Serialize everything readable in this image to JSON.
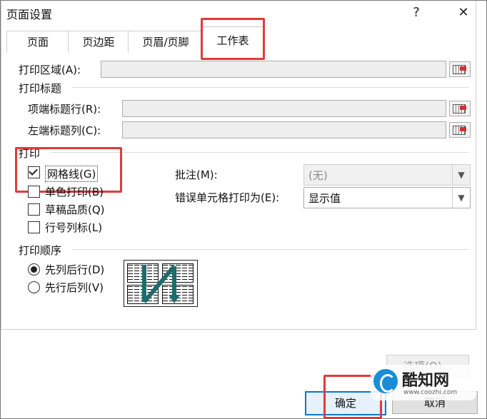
{
  "window": {
    "title": "页面设置",
    "help_symbol": "?",
    "close_symbol": "✕"
  },
  "tabs": [
    {
      "label": "页面"
    },
    {
      "label": "页边距"
    },
    {
      "label": "页眉/页脚"
    },
    {
      "label": "工作表",
      "active": true
    }
  ],
  "sheet": {
    "print_area_label": "打印区域(A):",
    "print_titles_section": "打印标题",
    "rows_repeat_label": "项端标题行(R):",
    "cols_repeat_label": "左端标题列(C):",
    "print_section": "打印",
    "gridlines": {
      "label": "网格线(G)",
      "checked": true
    },
    "black_white": {
      "label": "单色打印(B)",
      "checked": false
    },
    "draft": {
      "label": "草稿品质(Q)",
      "checked": false
    },
    "headings": {
      "label": "行号列标(L)",
      "checked": false
    },
    "comments_label": "批注(M):",
    "comments_value": "(无)",
    "errors_label": "错误单元格打印为(E):",
    "errors_value": "显示值",
    "order_section": "打印顺序",
    "order_down_over": {
      "label": "先列后行(D)",
      "selected": true
    },
    "order_over_down": {
      "label": "先行后列(V)",
      "selected": false
    }
  },
  "footer": {
    "options_label": "选项(O)...",
    "ok_label": "确定",
    "cancel_label": "取消"
  },
  "watermark": {
    "brand_text": "酷知网",
    "url_text": "www.coozhi.com"
  },
  "colors": {
    "highlight": "#e03b3b",
    "accent": "#0078d7",
    "brand": "#1a8cd8"
  }
}
